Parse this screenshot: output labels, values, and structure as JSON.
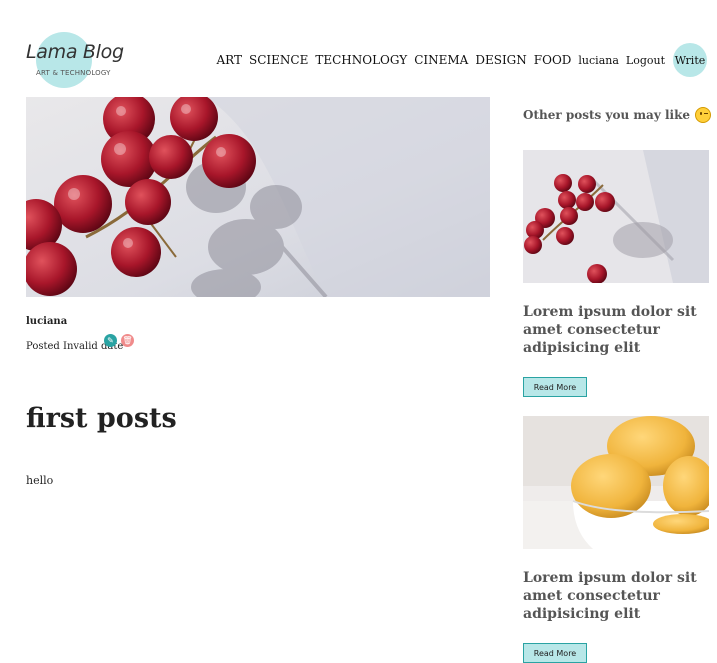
{
  "logo": {
    "name": "Lama Blog",
    "tagline": "ART & TECHNOLOGY"
  },
  "nav": {
    "items": [
      "ART",
      "SCIENCE",
      "TECHNOLOGY",
      "CINEMA",
      "DESIGN",
      "FOOD"
    ],
    "user": "luciana",
    "logout": "Logout",
    "write": "Write"
  },
  "post": {
    "image": "grapes-photo",
    "author": "luciana",
    "posted": "Posted Invalid date",
    "title": "first posts",
    "body": "hello"
  },
  "sidebar": {
    "heading": "Other posts you may like",
    "cards": [
      {
        "image": "grapes-photo",
        "title": "Lorem ipsum dolor sit amet consectetur adipisicing elit",
        "button": "Read More"
      },
      {
        "image": "lemons-photo",
        "title": "Lorem ipsum dolor sit amet consectetur adipisicing elit",
        "button": "Read More"
      }
    ]
  },
  "colors": {
    "accent": "#b8e7e8",
    "accent_border": "#2aa3a3",
    "delete": "#f08b8b"
  }
}
